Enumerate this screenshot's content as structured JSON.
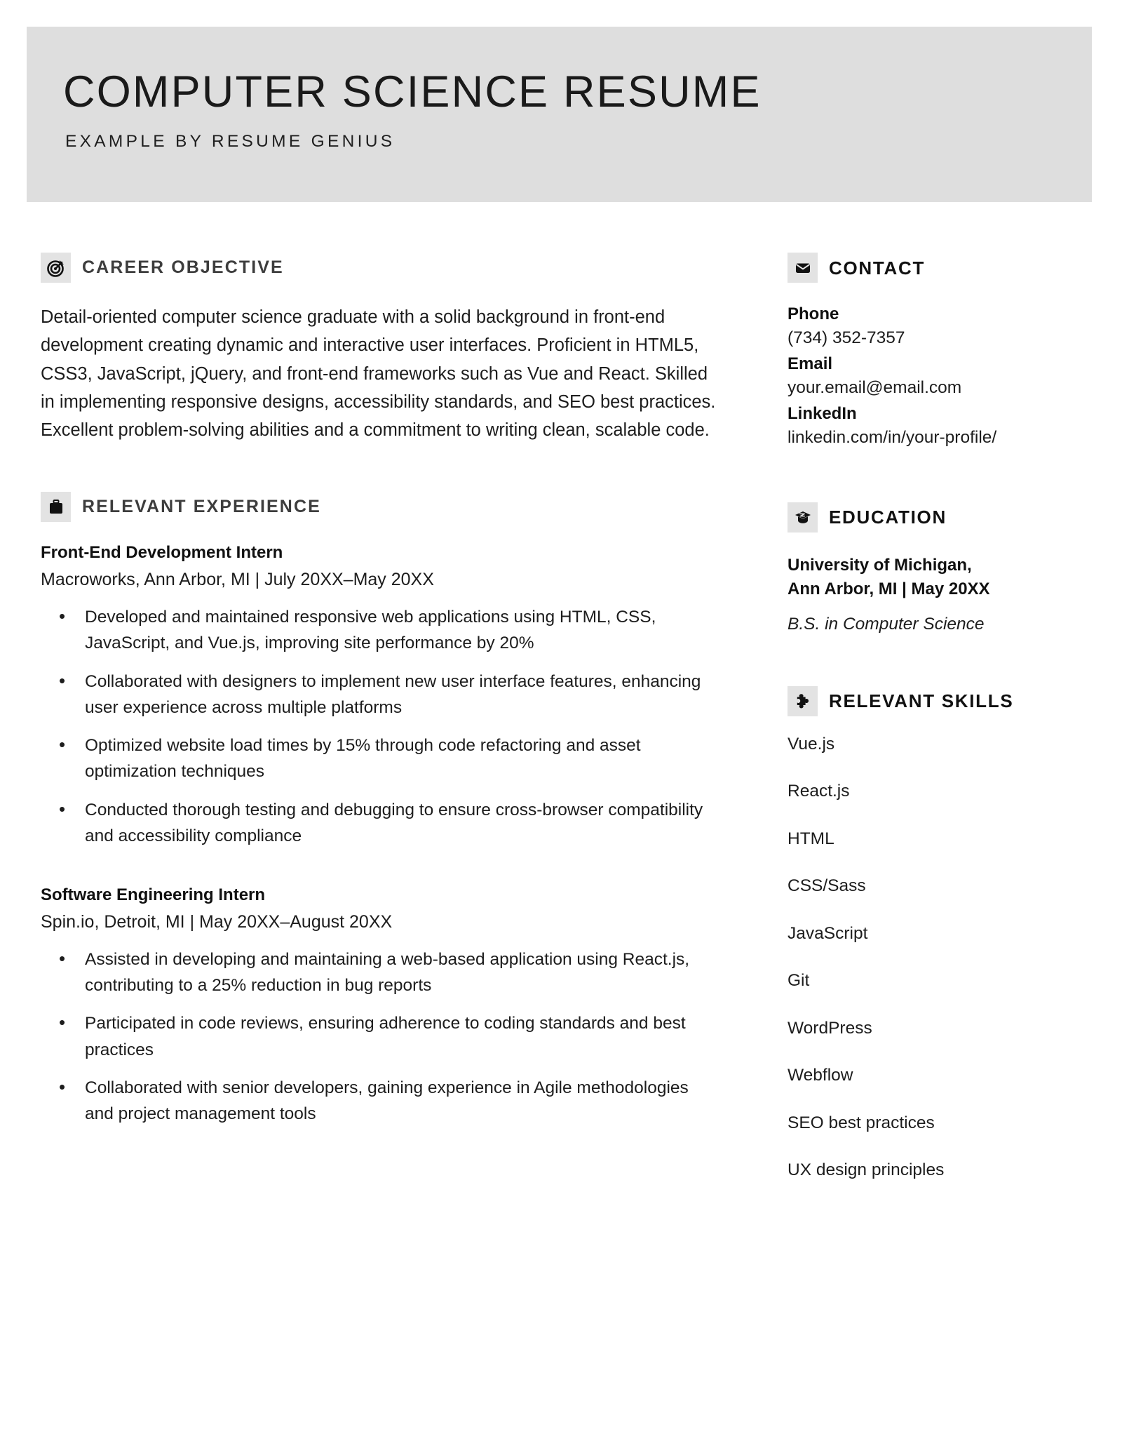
{
  "header": {
    "title": "COMPUTER SCIENCE RESUME",
    "subtitle": "EXAMPLE BY RESUME GENIUS",
    "banner_color": "#dedede"
  },
  "theme": {
    "icon_box_color": "#e3e3e3",
    "left_heading_color": "#3d3d3d",
    "right_heading_color": "#111111",
    "body_text_color": "#1d1d1d",
    "page_background": "#ffffff"
  },
  "left_column": {
    "objective": {
      "icon": "target-icon",
      "heading": "CAREER OBJECTIVE",
      "text": "Detail-oriented computer science graduate with a solid background in front-end development creating dynamic and interactive user interfaces. Proficient in HTML5, CSS3, JavaScript, jQuery, and front-end frameworks such as Vue and React. Skilled in implementing responsive designs, accessibility standards, and SEO best practices. Excellent problem-solving abilities and a commitment to writing clean, scalable code."
    },
    "experience": {
      "icon": "briefcase-icon",
      "heading": "RELEVANT EXPERIENCE",
      "jobs": [
        {
          "title": "Front-End Development Intern",
          "meta": "Macroworks, Ann Arbor, MI | July 20XX–May 20XX",
          "bullets": [
            "Developed and maintained responsive web applications using HTML, CSS, JavaScript, and Vue.js, improving site performance by 20%",
            "Collaborated with designers to implement new user interface features, enhancing user experience across multiple platforms",
            "Optimized website load times by 15% through code refactoring and asset optimization techniques",
            "Conducted thorough testing and debugging to ensure cross-browser compatibility and accessibility compliance"
          ]
        },
        {
          "title": "Software Engineering Intern",
          "meta": "Spin.io, Detroit, MI | May 20XX–August 20XX",
          "bullets": [
            "Assisted in developing and maintaining a web-based application using React.js, contributing to a 25% reduction in bug reports",
            "Participated in code reviews, ensuring adherence to coding standards and best practices",
            "Collaborated with senior developers, gaining experience in Agile methodologies and project management tools"
          ]
        }
      ]
    }
  },
  "right_column": {
    "contact": {
      "icon": "envelope-icon",
      "heading": "CONTACT",
      "entries": [
        {
          "label": "Phone",
          "value": "(734) 352-7357"
        },
        {
          "label": "Email",
          "value": "your.email@email.com"
        },
        {
          "label": "LinkedIn",
          "value": "linkedin.com/in/your-profile/"
        }
      ]
    },
    "education": {
      "icon": "graduation-cap-icon",
      "heading": "EDUCATION",
      "school_line1": "University of Michigan,",
      "school_line2": "Ann Arbor, MI | May 20XX",
      "degree": "B.S. in Computer Science"
    },
    "skills": {
      "icon": "puzzle-piece-icon",
      "heading": "RELEVANT SKILLS",
      "items": [
        "Vue.js",
        "React.js",
        "HTML",
        "CSS/Sass",
        "JavaScript",
        "Git",
        "WordPress",
        "Webflow",
        "SEO best practices",
        "UX design principles"
      ]
    }
  }
}
